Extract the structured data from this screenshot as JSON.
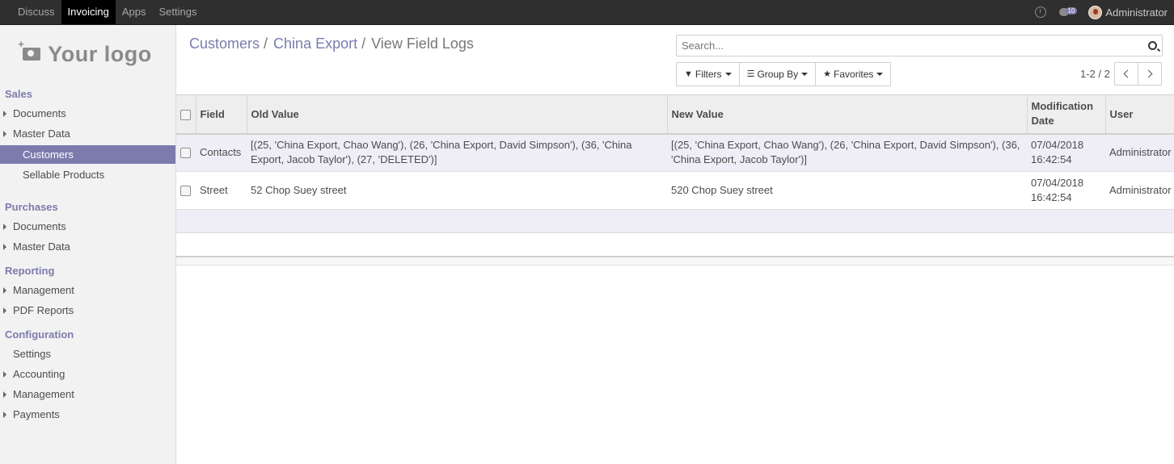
{
  "navbar": {
    "menu": [
      "Discuss",
      "Invoicing",
      "Apps",
      "Settings"
    ],
    "active": "Invoicing",
    "chat_count": "10",
    "user_name": "Administrator"
  },
  "sidebar": {
    "logo_text": "Your logo",
    "sections": [
      {
        "title": "Sales",
        "items": [
          {
            "label": "Documents",
            "type": "expandable"
          },
          {
            "label": "Master Data",
            "type": "expandable"
          },
          {
            "label": "Customers",
            "type": "sub",
            "active": true
          },
          {
            "label": "Sellable Products",
            "type": "sub"
          }
        ]
      },
      {
        "title": "Purchases",
        "items": [
          {
            "label": "Documents",
            "type": "expandable"
          },
          {
            "label": "Master Data",
            "type": "expandable"
          }
        ]
      },
      {
        "title": "Reporting",
        "items": [
          {
            "label": "Management",
            "type": "expandable"
          },
          {
            "label": "PDF Reports",
            "type": "expandable"
          }
        ]
      },
      {
        "title": "Configuration",
        "items": [
          {
            "label": "Settings",
            "type": "plain"
          },
          {
            "label": "Accounting",
            "type": "expandable"
          },
          {
            "label": "Management",
            "type": "expandable"
          },
          {
            "label": "Payments",
            "type": "expandable"
          }
        ]
      }
    ]
  },
  "breadcrumb": {
    "items": [
      "Customers",
      "China Export"
    ],
    "current": "View Field Logs"
  },
  "search": {
    "placeholder": "Search..."
  },
  "toolbar": {
    "filters_label": "Filters",
    "groupby_label": "Group By",
    "favorites_label": "Favorites"
  },
  "pager": {
    "value": "1-2 / 2"
  },
  "table": {
    "columns": [
      "Field",
      "Old Value",
      "New Value",
      "Modification Date",
      "User"
    ],
    "rows": [
      {
        "field": "Contacts",
        "old_value": "[(25, 'China Export, Chao Wang'), (26, 'China Export, David Simpson'), (36, 'China Export, Jacob Taylor'), (27, 'DELETED')]",
        "new_value": "[(25, 'China Export, Chao Wang'), (26, 'China Export, David Simpson'), (36, 'China Export, Jacob Taylor')]",
        "date": "07/04/2018 16:42:54",
        "user": "Administrator"
      },
      {
        "field": "Street",
        "old_value": "52 Chop Suey street",
        "new_value": "520 Chop Suey street",
        "date": "07/04/2018 16:42:54",
        "user": "Administrator"
      }
    ]
  },
  "colors": {
    "brand": "#7c7bad",
    "navbar": "#2f2f2f",
    "row_highlight": "#efeef6"
  }
}
